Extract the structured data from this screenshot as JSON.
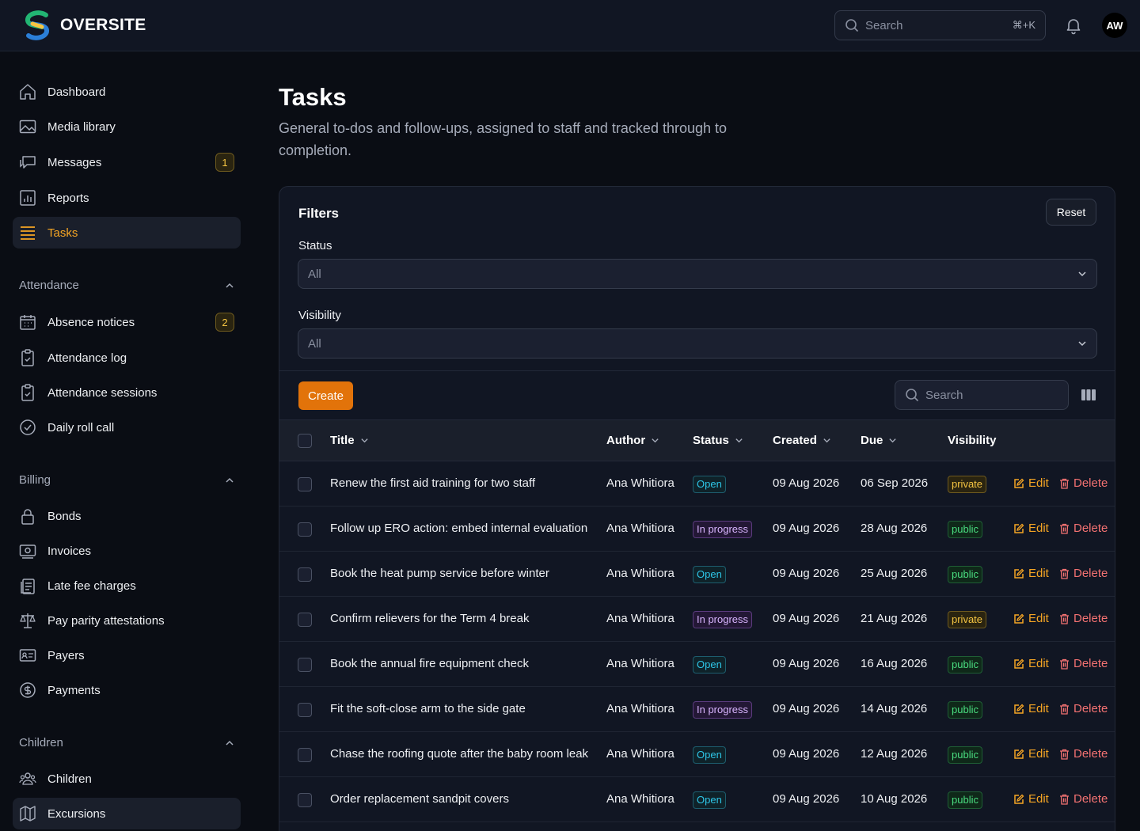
{
  "brand": {
    "name": "OVERSITE"
  },
  "topbar": {
    "search_placeholder": "Search",
    "search_shortcut": "⌘+K",
    "avatar_initials": "AW"
  },
  "sidebar": {
    "main_items": [
      {
        "label": "Dashboard",
        "icon": "home-icon"
      },
      {
        "label": "Media library",
        "icon": "image-icon"
      },
      {
        "label": "Messages",
        "icon": "chat-icon",
        "badge": "1"
      },
      {
        "label": "Reports",
        "icon": "chart-icon"
      },
      {
        "label": "Tasks",
        "icon": "list-icon",
        "active": true
      }
    ],
    "sections": [
      {
        "title": "Attendance",
        "items": [
          {
            "label": "Absence notices",
            "icon": "calendar-icon",
            "badge": "2"
          },
          {
            "label": "Attendance log",
            "icon": "clipboard-icon"
          },
          {
            "label": "Attendance sessions",
            "icon": "clipboard-icon"
          },
          {
            "label": "Daily roll call",
            "icon": "check-circle-icon"
          }
        ]
      },
      {
        "title": "Billing",
        "items": [
          {
            "label": "Bonds",
            "icon": "lock-icon"
          },
          {
            "label": "Invoices",
            "icon": "banknote-icon"
          },
          {
            "label": "Late fee charges",
            "icon": "receipt-icon"
          },
          {
            "label": "Pay parity attestations",
            "icon": "scale-icon"
          },
          {
            "label": "Payers",
            "icon": "id-card-icon"
          },
          {
            "label": "Payments",
            "icon": "dollar-icon"
          }
        ]
      },
      {
        "title": "Children",
        "items": [
          {
            "label": "Children",
            "icon": "users-icon"
          },
          {
            "label": "Excursions",
            "icon": "map-icon",
            "highlight": true
          }
        ]
      }
    ]
  },
  "page": {
    "title": "Tasks",
    "subtitle": "General to-dos and follow-ups, assigned to staff and tracked through to completion."
  },
  "filters": {
    "title": "Filters",
    "reset_label": "Reset",
    "status_label": "Status",
    "status_value": "All",
    "visibility_label": "Visibility",
    "visibility_value": "All"
  },
  "toolbar": {
    "create_label": "Create",
    "search_placeholder": "Search"
  },
  "table": {
    "columns": {
      "title": "Title",
      "author": "Author",
      "status": "Status",
      "created": "Created",
      "due": "Due",
      "visibility": "Visibility"
    },
    "edit_label": "Edit",
    "delete_label": "Delete",
    "rows": [
      {
        "title": "Renew the first aid training for two staff",
        "author": "Ana Whitiora",
        "status": "Open",
        "created": "09 Aug 2026",
        "due": "06 Sep 2026",
        "visibility": "private"
      },
      {
        "title": "Follow up ERO action: embed internal evaluation",
        "author": "Ana Whitiora",
        "status": "In progress",
        "created": "09 Aug 2026",
        "due": "28 Aug 2026",
        "visibility": "public"
      },
      {
        "title": "Book the heat pump service before winter",
        "author": "Ana Whitiora",
        "status": "Open",
        "created": "09 Aug 2026",
        "due": "25 Aug 2026",
        "visibility": "public"
      },
      {
        "title": "Confirm relievers for the Term 4 break",
        "author": "Ana Whitiora",
        "status": "In progress",
        "created": "09 Aug 2026",
        "due": "21 Aug 2026",
        "visibility": "private"
      },
      {
        "title": "Book the annual fire equipment check",
        "author": "Ana Whitiora",
        "status": "Open",
        "created": "09 Aug 2026",
        "due": "16 Aug 2026",
        "visibility": "public"
      },
      {
        "title": "Fit the soft-close arm to the side gate",
        "author": "Ana Whitiora",
        "status": "In progress",
        "created": "09 Aug 2026",
        "due": "14 Aug 2026",
        "visibility": "public"
      },
      {
        "title": "Chase the roofing quote after the baby room leak",
        "author": "Ana Whitiora",
        "status": "Open",
        "created": "09 Aug 2026",
        "due": "12 Aug 2026",
        "visibility": "public"
      },
      {
        "title": "Order replacement sandpit covers",
        "author": "Ana Whitiora",
        "status": "Open",
        "created": "09 Aug 2026",
        "due": "10 Aug 2026",
        "visibility": "public"
      }
    ]
  },
  "colors": {
    "accent": "#f5a524",
    "create": "#e2730a",
    "background": "#0a0d14",
    "panel": "#111623"
  }
}
